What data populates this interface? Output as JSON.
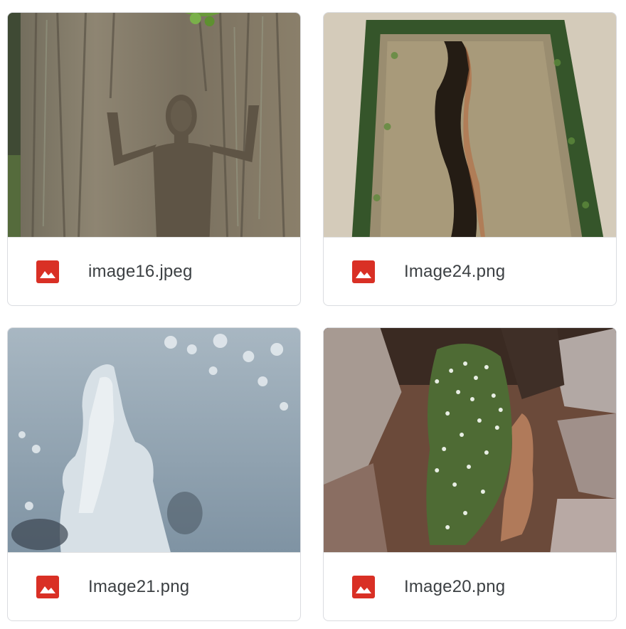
{
  "files": [
    {
      "name": "image16.jpeg",
      "type_icon": "image-file-icon",
      "thumbnail": "bark-figure-thumbnail"
    },
    {
      "name": "Image24.png",
      "type_icon": "image-file-icon",
      "thumbnail": "earth-trench-thumbnail"
    },
    {
      "name": "Image21.png",
      "type_icon": "image-file-icon",
      "thumbnail": "ice-figure-thumbnail"
    },
    {
      "name": "Image20.png",
      "type_icon": "image-file-icon",
      "thumbnail": "flower-figure-thumbnail"
    }
  ],
  "colors": {
    "file_icon": "#d93025",
    "card_border": "#dadce0",
    "file_name": "#3c4043"
  }
}
